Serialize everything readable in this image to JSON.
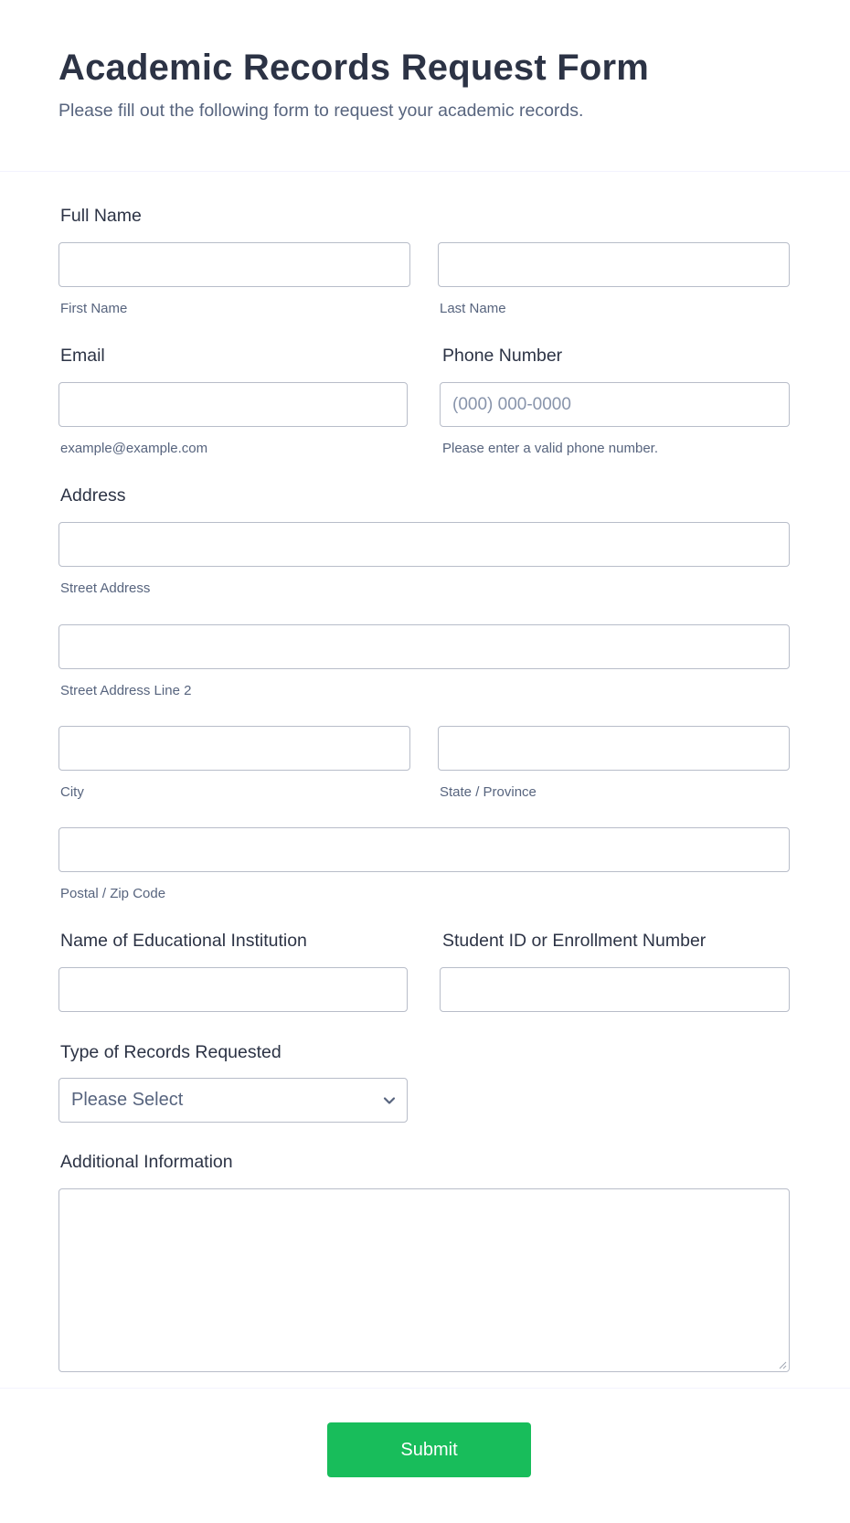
{
  "header": {
    "title": "Academic Records Request Form",
    "subtitle": "Please fill out the following form to request your academic records."
  },
  "fields": {
    "full_name": {
      "label": "Full Name",
      "first": {
        "value": "",
        "sublabel": "First Name"
      },
      "last": {
        "value": "",
        "sublabel": "Last Name"
      }
    },
    "email": {
      "label": "Email",
      "value": "",
      "sublabel": "example@example.com"
    },
    "phone": {
      "label": "Phone Number",
      "value": "",
      "placeholder": "(000) 000-0000",
      "sublabel": "Please enter a valid phone number."
    },
    "address": {
      "label": "Address",
      "street1": {
        "value": "",
        "sublabel": "Street Address"
      },
      "street2": {
        "value": "",
        "sublabel": "Street Address Line 2"
      },
      "city": {
        "value": "",
        "sublabel": "City"
      },
      "state": {
        "value": "",
        "sublabel": "State / Province"
      },
      "zip": {
        "value": "",
        "sublabel": "Postal / Zip Code"
      }
    },
    "institution": {
      "label": "Name of Educational Institution",
      "value": ""
    },
    "student_id": {
      "label": "Student ID or Enrollment Number",
      "value": ""
    },
    "record_type": {
      "label": "Type of Records Requested",
      "selected": "Please Select"
    },
    "additional_info": {
      "label": "Additional Information",
      "value": ""
    }
  },
  "submit": {
    "label": "Submit"
  },
  "colors": {
    "accent": "#18bd5b",
    "text": "#2c3345",
    "muted": "#57647e",
    "border": "#b8bdc9"
  }
}
